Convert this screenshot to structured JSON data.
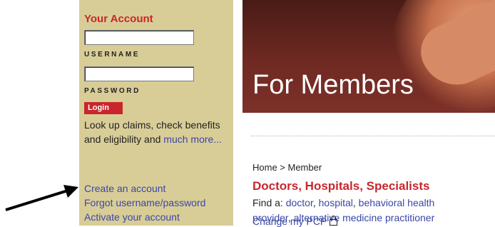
{
  "sidebar": {
    "title": "Your Account",
    "username_label": "USERNAME",
    "password_label": "PASSWORD",
    "login_label": "Login",
    "blurb": "Look up claims, check benefits and eligibility and",
    "blurb_more": "much more...",
    "links": [
      "Create an account",
      "Forgot username/password",
      "Activate your account"
    ]
  },
  "banner": {
    "title": "For Members"
  },
  "main": {
    "breadcrumb": "Home > Member",
    "section_title": "Doctors, Hospitals, Specialists",
    "find_prefix": "Find a: ",
    "find_links": [
      "doctor",
      "hospital",
      "behavioral health",
      "provider",
      "alternative medicine practitioner"
    ],
    "change_pcp": "Change my PCP"
  },
  "colors": {
    "sidebar_bg": "#d9cd97",
    "accent_red": "#c8262c",
    "link_blue": "#3a46a8"
  },
  "icons": [
    "lock-icon",
    "arrow-icon"
  ]
}
